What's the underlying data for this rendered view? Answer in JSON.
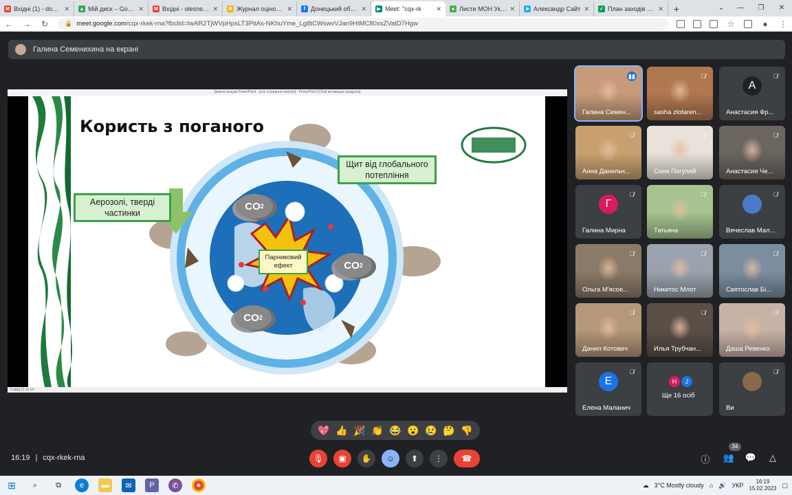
{
  "browser": {
    "tabs": [
      {
        "label": "Вхідні (1) - donce",
        "color": "#ea4335",
        "icon": "gmail-icon",
        "glyph": "M"
      },
      {
        "label": "Мій диск – Google",
        "color": "#34a853",
        "icon": "drive-icon",
        "glyph": "▲"
      },
      {
        "label": "Вхідні - olesnevic",
        "color": "#ea4335",
        "icon": "gmail-icon",
        "glyph": "M"
      },
      {
        "label": "Журнал оцінок: Г",
        "color": "#f4b400",
        "icon": "journal-icon",
        "glyph": "Ж"
      },
      {
        "label": "Донецький облас",
        "color": "#1877f2",
        "icon": "facebook-icon",
        "glyph": "f"
      },
      {
        "label": "Meet: \"cqx-rk",
        "color": "#00897b",
        "icon": "meet-icon",
        "glyph": "▶",
        "active": true
      },
      {
        "label": "Листи МОН Украї",
        "color": "#4caf50",
        "icon": "site-icon",
        "glyph": "●"
      },
      {
        "label": "Александр Сайт",
        "color": "#2aabee",
        "icon": "telegram-icon",
        "glyph": "➤"
      },
      {
        "label": "План заходів НП",
        "color": "#0f9d58",
        "icon": "site-icon",
        "glyph": "✓"
      }
    ],
    "new_tab": "+",
    "url_host": "meet.google.com",
    "url_path": "/cqx-rkek-rna?fbclid=IwAR2TjWVpHpsLT3PitAs-NKhuYme_Lg8tCWswvVJan9HtMC80xsZVatD7Hgw"
  },
  "meet": {
    "presenting_label": "Галина Семенихина на екрані",
    "time": "16:19",
    "separator": "|",
    "meeting_code": "cqx-rkek-rna",
    "participant_count": "34",
    "reactions": [
      "💖",
      "👍",
      "🎉",
      "👏",
      "😂",
      "😮",
      "😢",
      "🤔",
      "👎"
    ]
  },
  "slide": {
    "window_title": "Демонстрация PowerPoint - [сло іслування повітря] - PowerPoint (Сбой активации продукта)",
    "title": "Користь з поганого",
    "box_left": "Аерозолі, тверді частинки",
    "box_right": "Щит від глобального потепління",
    "center_label": "Парниковий ефект",
    "co2_main": "CO",
    "co2_sub": "2",
    "status": "Слайд 11 из 14"
  },
  "participants": [
    {
      "name": "Галина Семен...",
      "kind": "photo",
      "bg": "#c79b7a",
      "mic": "active",
      "speaking": true
    },
    {
      "name": "sasha zlotaren...",
      "kind": "photo",
      "bg": "#b07850",
      "mic": "muted"
    },
    {
      "name": "Анастасия Фр...",
      "kind": "letter",
      "letter": "А",
      "bg": "#3c4043",
      "circle": "#202124",
      "mic": "muted"
    },
    {
      "name": "Анна Данильч...",
      "kind": "photo",
      "bg": "#c8a070",
      "mic": "muted"
    },
    {
      "name": "Соня Погуляй",
      "kind": "photo",
      "bg": "#e8e2da",
      "mic": "muted"
    },
    {
      "name": "Анастасия Че...",
      "kind": "photo",
      "bg": "#6b6560",
      "mic": "muted"
    },
    {
      "name": "Галина Мирна",
      "kind": "letter",
      "letter": "Г",
      "bg": "#3c4043",
      "circle": "#d81b60",
      "mic": "muted"
    },
    {
      "name": "Татьяна",
      "kind": "photo",
      "bg": "#a7c490",
      "mic": "muted"
    },
    {
      "name": "Вячеслав Мал...",
      "kind": "avatar",
      "bg": "#3c4043",
      "circle": "#4a7bc8",
      "mic": "muted"
    },
    {
      "name": "Ольга М'ясое...",
      "kind": "photo",
      "bg": "#8c7a68",
      "mic": "muted"
    },
    {
      "name": "Никитос Млот",
      "kind": "photo",
      "bg": "#9aa3ad",
      "mic": "muted"
    },
    {
      "name": "Святослав Бі...",
      "kind": "photo",
      "bg": "#7b8ea0",
      "mic": "muted"
    },
    {
      "name": "Данил Котович",
      "kind": "photo",
      "bg": "#b49878",
      "mic": "muted"
    },
    {
      "name": "Илья Трубчан...",
      "kind": "photo",
      "bg": "#5b5048",
      "mic": "muted"
    },
    {
      "name": "Даша Ревенко",
      "kind": "photo",
      "bg": "#c7b2a5",
      "mic": "muted"
    },
    {
      "name": "Елена Маланич",
      "kind": "letter",
      "letter": "Е",
      "bg": "#3c4043",
      "circle": "#1a73e8",
      "mic": "muted"
    },
    {
      "name": "Ще 16 осіб",
      "kind": "more",
      "bg": "#3c4043",
      "mic": "none"
    },
    {
      "name": "Ви",
      "kind": "avatar",
      "bg": "#3c4043",
      "circle": "#8a6a4c",
      "mic": "muted"
    }
  ],
  "more_letters": [
    "Н",
    "J"
  ],
  "taskbar": {
    "weather": "3°C  Mostly cloudy",
    "lang": "УКР",
    "clock_time": "16:19",
    "clock_date": "15.02.2023"
  }
}
